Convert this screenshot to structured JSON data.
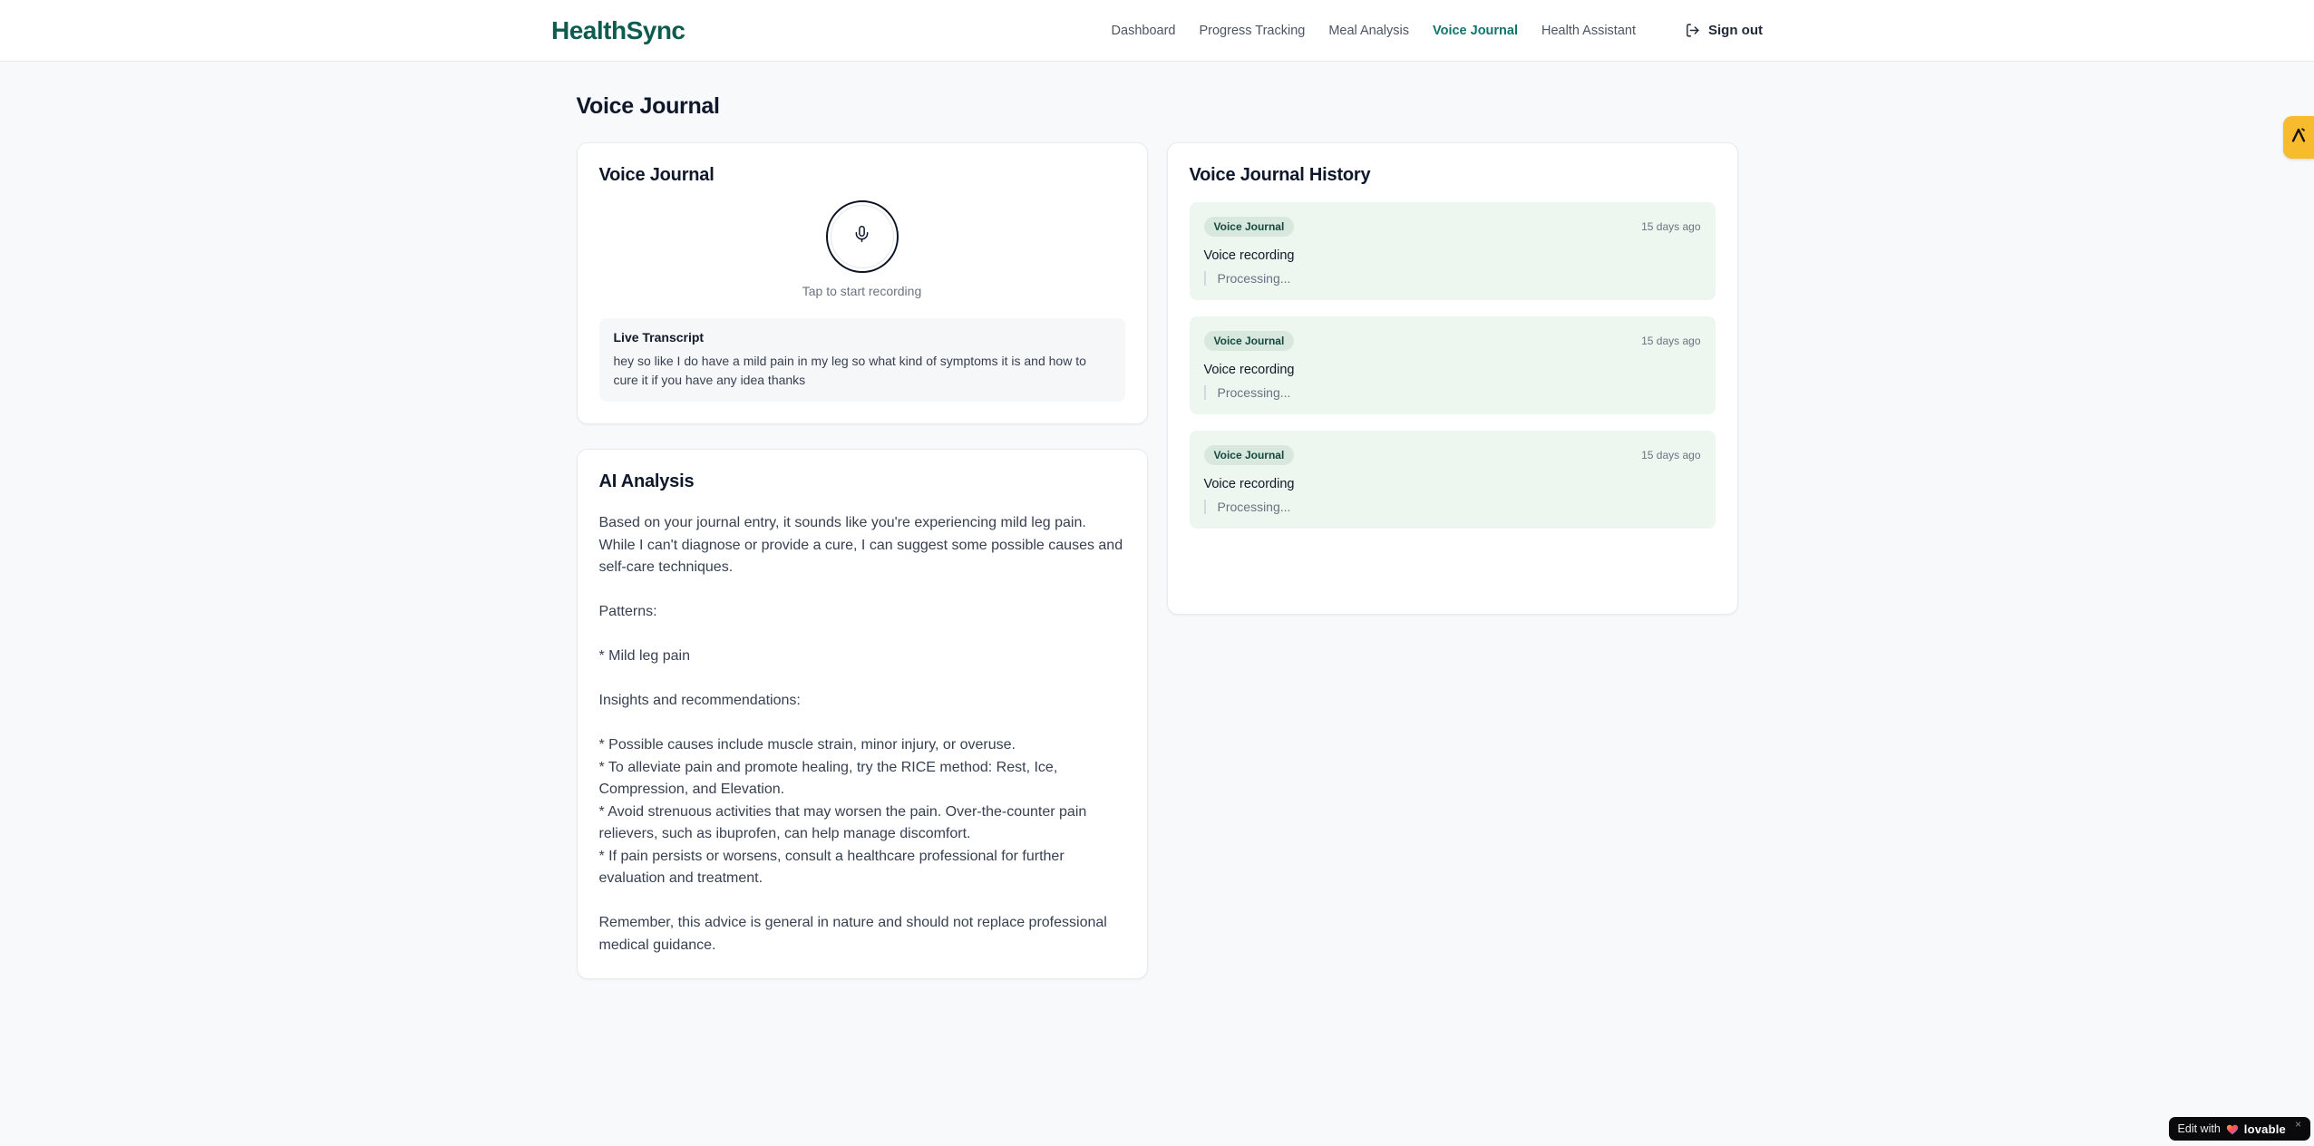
{
  "header": {
    "logo": "HealthSync",
    "nav": [
      {
        "label": "Dashboard",
        "active": false
      },
      {
        "label": "Progress Tracking",
        "active": false
      },
      {
        "label": "Meal Analysis",
        "active": false
      },
      {
        "label": "Voice Journal",
        "active": true
      },
      {
        "label": "Health Assistant",
        "active": false
      }
    ],
    "signout_label": "Sign out"
  },
  "page": {
    "title": "Voice Journal"
  },
  "recorder_card": {
    "title": "Voice Journal",
    "mic_hint": "Tap to start recording",
    "transcript_title": "Live Transcript",
    "transcript_text": "hey so like I do have a mild pain in my leg so what kind of symptoms it is and how to cure it if you have any idea thanks"
  },
  "analysis_card": {
    "title": "AI Analysis",
    "body": "Based on your journal entry, it sounds like you're experiencing mild leg pain. While I can't diagnose or provide a cure, I can suggest some possible causes and self-care techniques.\n\nPatterns:\n\n* Mild leg pain\n\nInsights and recommendations:\n\n* Possible causes include muscle strain, minor injury, or overuse.\n* To alleviate pain and promote healing, try the RICE method: Rest, Ice, Compression, and Elevation.\n* Avoid strenuous activities that may worsen the pain. Over-the-counter pain relievers, such as ibuprofen, can help manage discomfort.\n* If pain persists or worsens, consult a healthcare professional for further evaluation and treatment.\n\nRemember, this advice is general in nature and should not replace professional medical guidance."
  },
  "history_card": {
    "title": "Voice Journal History",
    "items": [
      {
        "badge": "Voice Journal",
        "time": "15 days ago",
        "title": "Voice recording",
        "status": "Processing..."
      },
      {
        "badge": "Voice Journal",
        "time": "15 days ago",
        "title": "Voice recording",
        "status": "Processing..."
      },
      {
        "badge": "Voice Journal",
        "time": "15 days ago",
        "title": "Voice recording",
        "status": "Processing..."
      }
    ]
  },
  "floating": {
    "edit_badge_prefix": "Edit with",
    "edit_badge_brand": "lovable",
    "edit_badge_close": "×"
  },
  "colors": {
    "brand_green": "#0e5c50",
    "active_nav": "#0f766e",
    "history_item_bg": "#eef6f0",
    "history_badge_bg": "#d9e8de",
    "history_badge_text": "#15493f",
    "corner_badge_amber": "#f9bb2e",
    "edit_badge_bg": "#0a0a0c"
  }
}
